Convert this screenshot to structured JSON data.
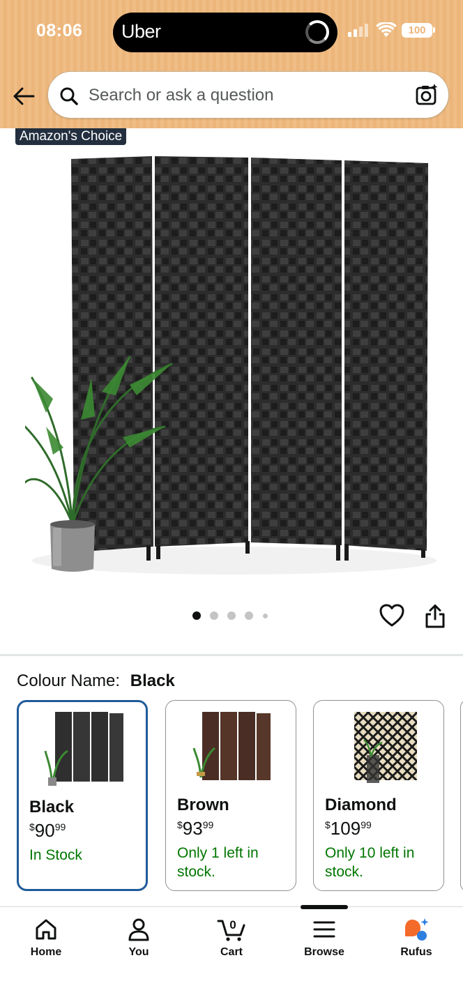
{
  "status_bar": {
    "time": "08:06",
    "live_activity_app": "Uber",
    "battery": "100"
  },
  "search": {
    "placeholder": "Search or ask a question"
  },
  "product": {
    "badge": "Amazon's Choice",
    "image_count": 5,
    "active_image_index": 0
  },
  "variants": {
    "label": "Colour Name:",
    "selected": "Black",
    "options": [
      {
        "name": "Black",
        "price_main": "90",
        "price_fraction": "99",
        "currency": "$",
        "stock": "In Stock",
        "selected": true
      },
      {
        "name": "Brown",
        "price_main": "93",
        "price_fraction": "99",
        "currency": "$",
        "stock": "Only 1 left in stock.",
        "selected": false
      },
      {
        "name": "Diamond",
        "price_main": "109",
        "price_fraction": "99",
        "currency": "$",
        "stock": "Only 10 left in stock.",
        "selected": false
      }
    ]
  },
  "bottom_nav": {
    "items": [
      {
        "label": "Home",
        "icon": "home-icon"
      },
      {
        "label": "You",
        "icon": "person-icon"
      },
      {
        "label": "Cart",
        "icon": "cart-icon",
        "count": "0"
      },
      {
        "label": "Browse",
        "icon": "menu-icon"
      },
      {
        "label": "Rufus",
        "icon": "rufus-icon"
      }
    ],
    "active": "Browse"
  },
  "colors": {
    "header_bg": "#efbd85",
    "in_stock": "#007600",
    "selected_border": "#1f5b99",
    "badge_bg": "#232f3e"
  }
}
